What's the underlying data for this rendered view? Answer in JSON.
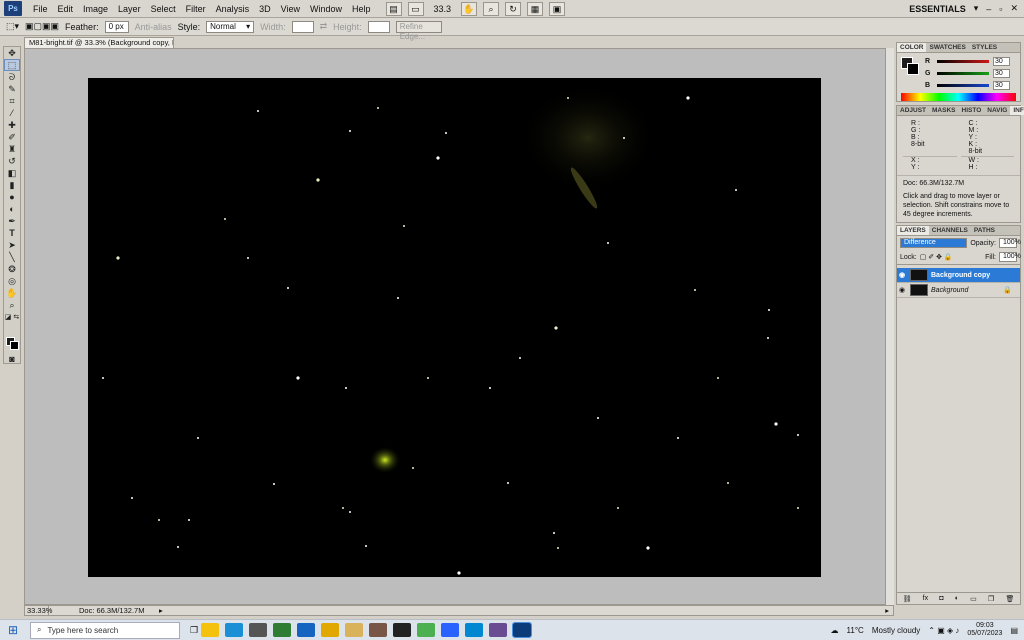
{
  "app": {
    "logo": "Ps"
  },
  "menu": [
    "File",
    "Edit",
    "Image",
    "Layer",
    "Select",
    "Filter",
    "Analysis",
    "3D",
    "View",
    "Window",
    "Help"
  ],
  "menubar": {
    "zoom": "33.3",
    "workspace": "ESSENTIALS"
  },
  "options": {
    "feather_label": "Feather:",
    "feather_value": "0 px",
    "antialias": "Anti-alias",
    "style_label": "Style:",
    "style_value": "Normal",
    "width_label": "Width:",
    "height_label": "Height:",
    "refine_edge": "Refine Edge..."
  },
  "document": {
    "tab_title": "M81-bright.tif @ 33.3% (Background copy, RGB/16) *",
    "zoom": "33.33%",
    "doc_info": "Doc: 66.3M/132.7M"
  },
  "color_panel": {
    "tabs": [
      "COLOR",
      "SWATCHES",
      "STYLES"
    ],
    "channels": [
      {
        "label": "R",
        "value": "30",
        "color": "#d01818"
      },
      {
        "label": "G",
        "value": "30",
        "color": "#18a018"
      },
      {
        "label": "B",
        "value": "30",
        "color": "#1848d0"
      }
    ]
  },
  "info_panel": {
    "tabs": [
      "ADJUST",
      "MASKS",
      "HISTO",
      "NAVIG",
      "INFO"
    ],
    "left": [
      "R :",
      "G :",
      "B :",
      "8-bit"
    ],
    "right": [
      "C :",
      "M :",
      "Y :",
      "K :",
      "8-bit"
    ],
    "xy_left": [
      "X :",
      "Y :"
    ],
    "xy_right": [
      "W :",
      "H :"
    ],
    "doc": "Doc: 66.3M/132.7M",
    "hint": "Click and drag to move layer or selection. Shift constrains move to 45 degree increments."
  },
  "layers_panel": {
    "tabs": [
      "LAYERS",
      "CHANNELS",
      "PATHS"
    ],
    "blend_mode": "Difference",
    "opacity_label": "Opacity:",
    "opacity": "100%",
    "lock_label": "Lock:",
    "fill_label": "Fill:",
    "fill": "100%",
    "layers": [
      {
        "name": "Background copy",
        "selected": true
      },
      {
        "name": "Background",
        "selected": false
      }
    ]
  },
  "taskbar": {
    "search_placeholder": "Type here to search",
    "weather_temp": "11°C",
    "weather_desc": "Mostly cloudy",
    "time": "09:03",
    "date": "05/07/2023"
  }
}
